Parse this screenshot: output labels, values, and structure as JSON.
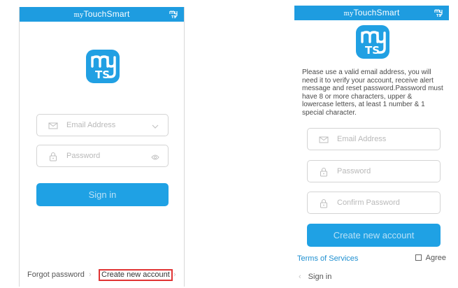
{
  "brand": {
    "prefix": "my",
    "name": "TouchSmart",
    "mini_logo": "my TS"
  },
  "colors": {
    "primary": "#1fa1e4",
    "link": "#1e8fd0",
    "highlight": "#e03434"
  },
  "login_screen": {
    "email_placeholder": "Email Address",
    "password_placeholder": "Password",
    "sign_in_label": "Sign in",
    "forgot_password_label": "Forgot password",
    "create_account_label": "Create new account",
    "icons": [
      "mail-icon",
      "chevron-down-icon",
      "lock-icon",
      "eye-icon",
      "chevron-right-icon"
    ]
  },
  "signup_screen": {
    "instructions": "Please use a valid email address, you will need it to verify your account, receive alert message and reset password.Password must have 8 or more characters, upper & lowercase letters, at least 1 number & 1 special character.",
    "email_placeholder": "Email Address",
    "password_placeholder": "Password",
    "confirm_password_placeholder": "Confirm Password",
    "create_account_label": "Create new account",
    "terms_label": "Terms of Services",
    "agree_label": "Agree",
    "agree_checked": false,
    "sign_in_label": "Sign in"
  }
}
